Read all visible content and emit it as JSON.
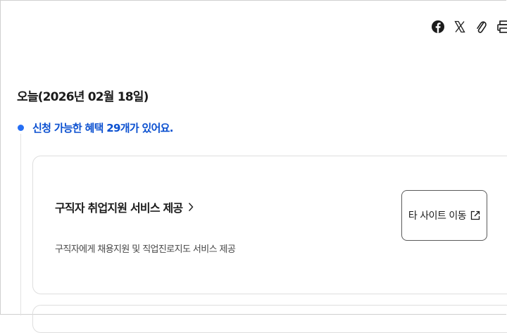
{
  "share": {
    "facebook": {
      "icon": "facebook-icon"
    },
    "x": {
      "icon": "x-icon"
    },
    "link": {
      "icon": "paperclip-icon"
    },
    "print": {
      "icon": "printer-icon"
    }
  },
  "date_title": "오늘(2026년 02월 18일)",
  "available_count_text": "신청 가능한 혜택 29개가 있어요.",
  "services": [
    {
      "title": "구직자 취업지원 서비스 제공",
      "description": "구직자에게 채용지원 및 직업진로지도 서비스 제공",
      "external_button_label": "타 사이트 이동"
    }
  ],
  "colors": {
    "accent_blue": "#256ef4",
    "count_text_blue": "#0b50d0",
    "text_dark": "#1b1b1b",
    "text_muted": "#464646",
    "card_border": "#dedede"
  }
}
